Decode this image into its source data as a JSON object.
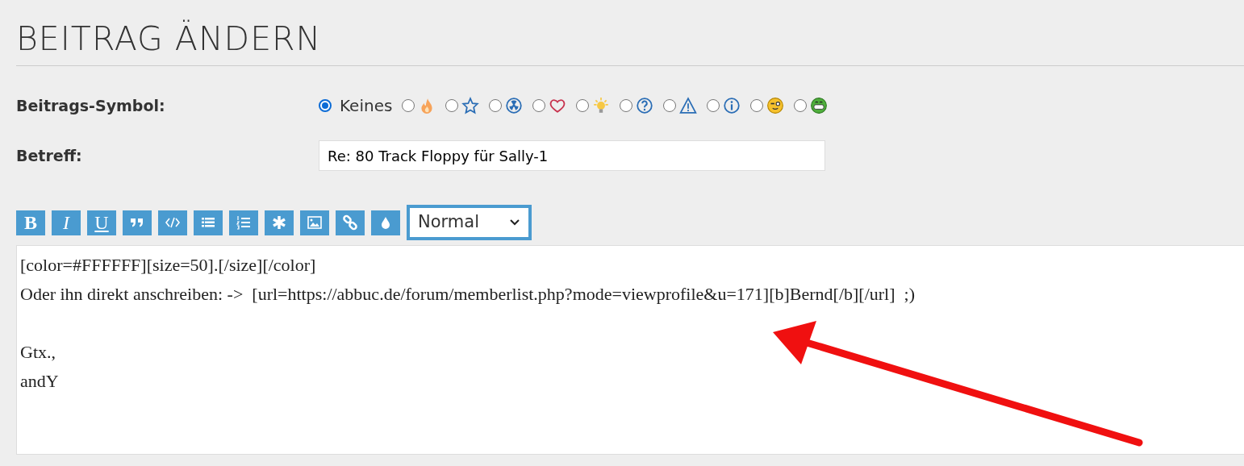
{
  "title": "BEITRAG ÄNDERN",
  "post_icon": {
    "label": "Beitrags-Symbol:",
    "options": [
      {
        "kind": "none",
        "text": "Keines",
        "selected": true
      },
      {
        "kind": "fire",
        "selected": false
      },
      {
        "kind": "star",
        "selected": false
      },
      {
        "kind": "radiation",
        "selected": false
      },
      {
        "kind": "heart",
        "selected": false
      },
      {
        "kind": "bulb",
        "selected": false
      },
      {
        "kind": "question",
        "selected": false
      },
      {
        "kind": "warning",
        "selected": false
      },
      {
        "kind": "info",
        "selected": false
      },
      {
        "kind": "wink",
        "selected": false
      },
      {
        "kind": "grin",
        "selected": false
      }
    ]
  },
  "subject": {
    "label": "Betreff:",
    "value": "Re: 80 Track Floppy für Sally-1"
  },
  "toolbar": [
    {
      "kind": "bold",
      "text": "B"
    },
    {
      "kind": "italic",
      "text": "I"
    },
    {
      "kind": "underline",
      "text": "U"
    },
    {
      "kind": "quote"
    },
    {
      "kind": "code"
    },
    {
      "kind": "list"
    },
    {
      "kind": "numbered-list"
    },
    {
      "kind": "asterisk"
    },
    {
      "kind": "image"
    },
    {
      "kind": "link"
    },
    {
      "kind": "drop"
    }
  ],
  "size_select": {
    "value": "Normal"
  },
  "message": "[color=#FFFFFF][size=50].[/size][/color]\nOder ihn direkt anschreiben: ->  [url=https://abbuc.de/forum/memberlist.php?mode=viewprofile&u=171][b]Bernd[/b][/url]  ;)\n\nGtx.,\nandY"
}
